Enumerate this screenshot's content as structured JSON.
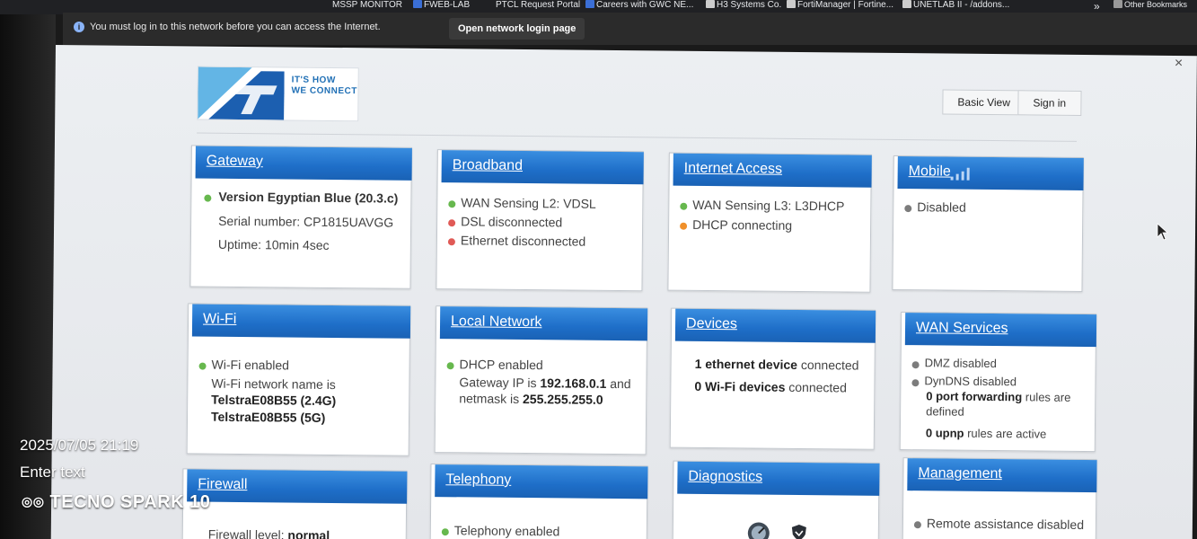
{
  "bookmarks": [
    "MSSP MONITOR",
    "FWEB-LAB",
    "PTCL Request Portal",
    "Careers with GWC NE...",
    "H3 Systems Co.",
    "FortiManager | Fortine...",
    "UNETLAB II - /addons...",
    "Other Bookmarks"
  ],
  "notice": {
    "message": "You must log in to this network before you can access the Internet.",
    "button": "Open network login page"
  },
  "header": {
    "tagline_1": "IT'S HOW",
    "tagline_2": "WE CONNECT",
    "basic_view": "Basic View",
    "sign_in": "Sign in"
  },
  "cards": {
    "gateway": {
      "title": "Gateway",
      "version": "Version Egyptian Blue (20.3.c)",
      "serial": "Serial number: CP1815UAVGG",
      "uptime": "Uptime: 10min 4sec"
    },
    "broadband": {
      "title": "Broadband",
      "l1": "WAN Sensing L2: VDSL",
      "l2": "DSL disconnected",
      "l3": "Ethernet disconnected"
    },
    "internet": {
      "title": "Internet Access",
      "l1": "WAN Sensing L3: L3DHCP",
      "l2": "DHCP connecting"
    },
    "mobile": {
      "title": "Mobile",
      "l1": "Disabled"
    },
    "wifi": {
      "title": "Wi-Fi",
      "l1": "Wi-Fi enabled",
      "l2": "Wi-Fi network name is",
      "ssid1": "TelstraE08B55 (2.4G)",
      "ssid2": "TelstraE08B55 (5G)"
    },
    "local": {
      "title": "Local Network",
      "l1": "DHCP enabled",
      "l2a": "Gateway IP is ",
      "ip": "192.168.0.1",
      "l2b": " and",
      "l3a": "netmask is ",
      "netmask": "255.255.255.0"
    },
    "devices": {
      "title": "Devices",
      "eth_count": "1 ethernet device",
      "eth_rest": " connected",
      "wifi_count": "0 Wi-Fi devices",
      "wifi_rest": " connected"
    },
    "wan": {
      "title": "WAN Services",
      "l1": "DMZ disabled",
      "l2": "DynDNS disabled",
      "pf_bold": "0 port forwarding",
      "pf_rest": " rules are",
      "pf_rest2": "defined",
      "upnp_bold": "0 upnp",
      "upnp_rest": " rules are active"
    },
    "firewall": {
      "title": "Firewall",
      "l1a": "Firewall level: ",
      "level": "normal"
    },
    "telephony": {
      "title": "Telephony",
      "l1": "Telephony enabled"
    },
    "diagnostics": {
      "title": "Diagnostics"
    },
    "management": {
      "title": "Management",
      "l1": "Remote assistance disabled"
    }
  },
  "camera_overlay": {
    "timestamp": "2025/07/05 21:19",
    "enter_text": "Enter text",
    "brand": "TECNO SPARK 10"
  },
  "colors": {
    "header_blue": "#1e6ec8",
    "status_green": "#67b84e",
    "status_red": "#e05a56",
    "status_orange": "#f0902a"
  }
}
